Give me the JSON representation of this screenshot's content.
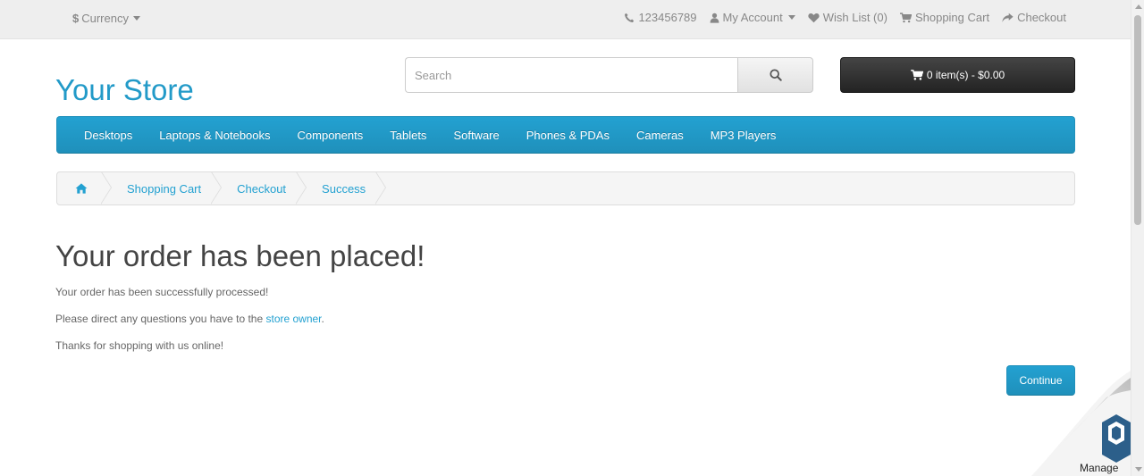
{
  "topbar": {
    "currency_symbol": "$",
    "currency_label": "Currency",
    "phone": "123456789",
    "my_account": "My Account",
    "wish_list": "Wish List (0)",
    "shopping_cart": "Shopping Cart",
    "checkout": "Checkout"
  },
  "header": {
    "logo": "Your Store",
    "search_placeholder": "Search",
    "cart_button": "0 item(s) - $0.00"
  },
  "menu": {
    "items": [
      "Desktops",
      "Laptops & Notebooks",
      "Components",
      "Tablets",
      "Software",
      "Phones & PDAs",
      "Cameras",
      "MP3 Players"
    ]
  },
  "breadcrumb": {
    "items": [
      "Shopping Cart",
      "Checkout",
      "Success"
    ]
  },
  "content": {
    "title": "Your order has been placed!",
    "line1": "Your order has been successfully processed!",
    "line2_prefix": "Please direct any questions you have to the ",
    "line2_link": "store owner",
    "line2_suffix": ".",
    "line3": "Thanks for shopping with us online!",
    "continue_label": "Continue"
  },
  "manage_widget": {
    "label": "Manage"
  },
  "colors": {
    "accent": "#229ac8",
    "topbar_bg": "#eeeeee",
    "cart_button_bg": "#303030"
  }
}
